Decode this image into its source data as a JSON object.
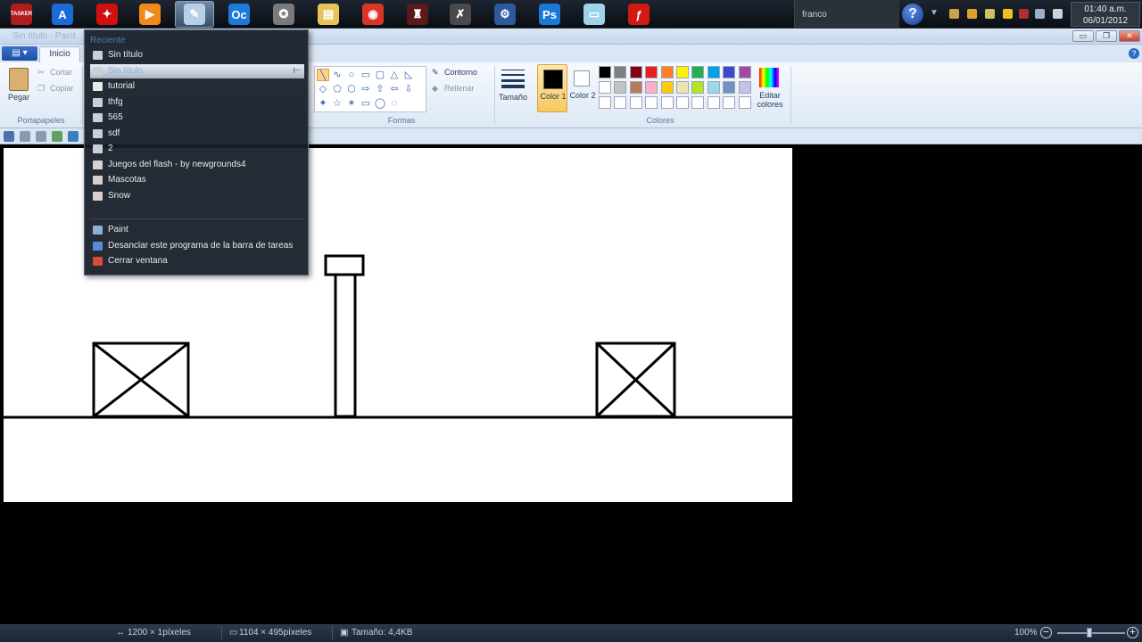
{
  "taskbar": {
    "apps": [
      {
        "name": "tasker-app",
        "label": "TASKER",
        "color": "#b11c1c"
      },
      {
        "name": "arch-app",
        "label": "A",
        "color": "#1b6ad6"
      },
      {
        "name": "fighter-app",
        "label": "✦",
        "color": "#d01010"
      },
      {
        "name": "video-app",
        "label": "▶",
        "color": "#f08a1a"
      },
      {
        "name": "paint-app",
        "label": "✎",
        "color": "#b8cfe8"
      },
      {
        "name": "oc-app",
        "label": "Oc",
        "color": "#1d7ad8"
      },
      {
        "name": "game-app",
        "label": "✪",
        "color": "#7a7a7a"
      },
      {
        "name": "explorer-app",
        "label": "▤",
        "color": "#e8c35a"
      },
      {
        "name": "chrome-app",
        "label": "◉",
        "color": "#d9362a"
      },
      {
        "name": "figure-app",
        "label": "♜",
        "color": "#5a1a1a"
      },
      {
        "name": "tool-app",
        "label": "✗",
        "color": "#4a4a4a"
      },
      {
        "name": "gear-app",
        "label": "⚙",
        "color": "#2c5a9a"
      },
      {
        "name": "photoshop-app",
        "label": "Ps",
        "color": "#1a78d8"
      },
      {
        "name": "notepad-app",
        "label": "▭",
        "color": "#9fd4e8"
      },
      {
        "name": "flash-app",
        "label": "ƒ",
        "color": "#d21a12"
      }
    ],
    "user": "franco",
    "help": "?",
    "clock_time": "01:40 a.m.",
    "clock_date": "06/01/2012"
  },
  "window": {
    "title": "Sin título - Paint",
    "minimize": "▭",
    "restore": "❐",
    "close": "✕"
  },
  "ribbon": {
    "tab_home": "Inicio",
    "paste": "Pegar",
    "cut": "Cortar",
    "copy": "Copiar",
    "group_clipboard": "Portapapeles",
    "outline": "Contorno",
    "fill": "Rellenar",
    "group_shapes": "Formas",
    "size": "Tamaño",
    "color1": "Color 1",
    "color2": "Color 2",
    "edit_colors": "Editar colores",
    "group_colors": "Colores",
    "palette_row1": [
      "#000000",
      "#7f7f7f",
      "#880015",
      "#ed1c24",
      "#ff7f27",
      "#fff200",
      "#22b14c",
      "#00a2e8",
      "#3f48cc",
      "#a349a4"
    ],
    "palette_row2": [
      "#ffffff",
      "#c3c3c3",
      "#b97a57",
      "#ffaec9",
      "#ffc90e",
      "#efe4b0",
      "#b5e61d",
      "#99d9ea",
      "#7092be",
      "#c8bfe7"
    ],
    "color1_value": "#000000",
    "color2_value": "#ffffff"
  },
  "jumplist": {
    "header": "Reciente",
    "recent": [
      {
        "label": "Sin título",
        "icon": "paint-file-icon"
      },
      {
        "label": "Sin título",
        "icon": "paint-file-icon"
      },
      {
        "label": "tutorial",
        "icon": "document-icon"
      },
      {
        "label": "thfg",
        "icon": "paint-file-icon"
      },
      {
        "label": "565",
        "icon": "paint-file-icon"
      },
      {
        "label": "sdf",
        "icon": "paint-file-icon"
      },
      {
        "label": "2",
        "icon": "paint-file-icon"
      },
      {
        "label": "Juegos del flash - by newgrounds4",
        "icon": "flash-file-icon"
      },
      {
        "label": "Mascotas",
        "icon": "flash-file-icon"
      },
      {
        "label": "Snow",
        "icon": "flash-file-icon"
      }
    ],
    "tasks": [
      {
        "label": "Paint",
        "icon": "paint-app-icon"
      },
      {
        "label": "Desanclar este programa de la barra de tareas",
        "icon": "unpin-icon"
      },
      {
        "label": "Cerrar ventana",
        "icon": "close-window-icon"
      }
    ]
  },
  "statusbar": {
    "cursor_pos": "1200 × 1píxeles",
    "selection_size": "1104 × 495píxeles",
    "file_size": "Tamaño: 4,4KB",
    "zoom": "100%"
  }
}
